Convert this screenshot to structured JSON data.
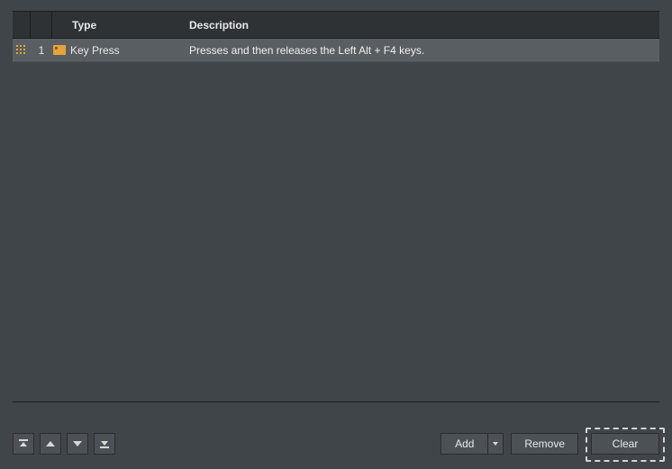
{
  "table": {
    "headers": {
      "type": "Type",
      "description": "Description"
    },
    "rows": [
      {
        "index": "1",
        "type": "Key Press",
        "description": "Presses and then releases the Left Alt + F4 keys."
      }
    ]
  },
  "footer": {
    "add": "Add",
    "remove": "Remove",
    "clear": "Clear"
  }
}
